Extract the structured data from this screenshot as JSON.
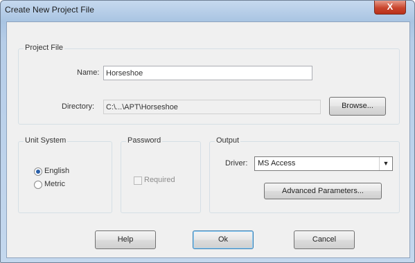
{
  "window": {
    "title": "Create New Project File",
    "close_label": "X"
  },
  "project_file": {
    "group_label": "Project File",
    "name_label": "Name:",
    "name_value": "Horseshoe",
    "directory_label": "Directory:",
    "directory_value": "C:\\...\\APT\\Horseshoe",
    "browse_label": "Browse..."
  },
  "unit_system": {
    "group_label": "Unit System",
    "english_label": "English",
    "metric_label": "Metric",
    "selected": "English"
  },
  "password": {
    "group_label": "Password",
    "required_label": "Required",
    "required_checked": false
  },
  "output": {
    "group_label": "Output",
    "driver_label": "Driver:",
    "driver_value": "MS Access",
    "advanced_label": "Advanced Parameters..."
  },
  "buttons": {
    "help": "Help",
    "ok": "Ok",
    "cancel": "Cancel"
  }
}
